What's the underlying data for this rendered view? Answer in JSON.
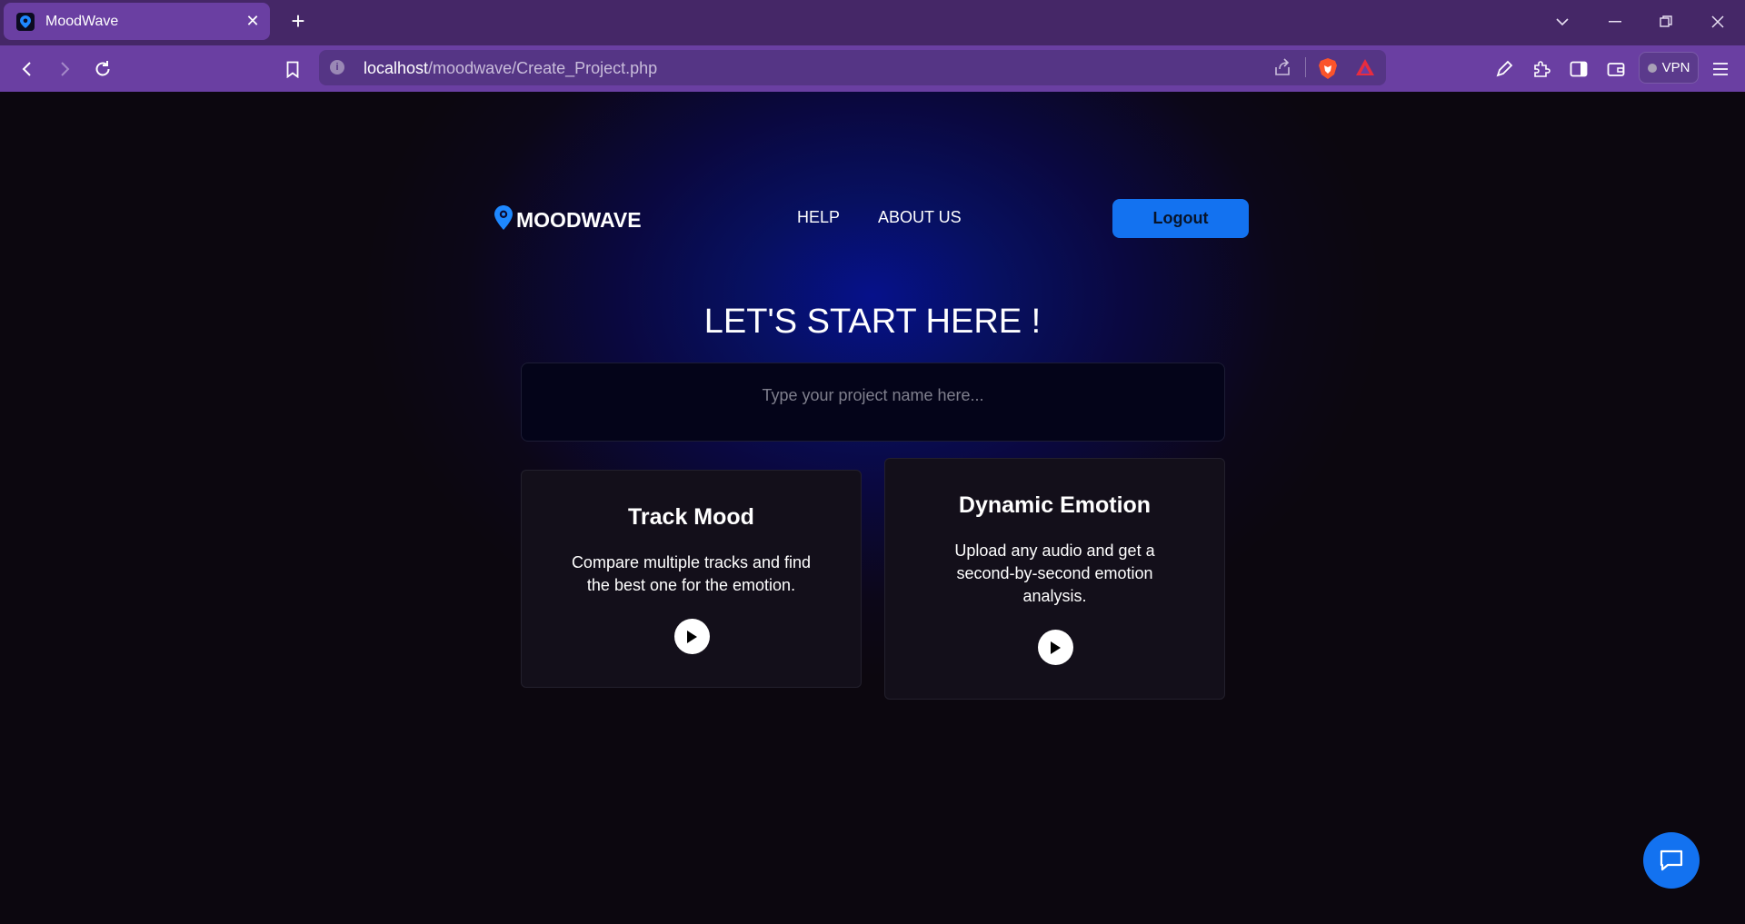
{
  "browser": {
    "tab_title": "MoodWave",
    "url_host": "localhost",
    "url_path": "/moodwave/Create_Project.php",
    "vpn_label": "VPN"
  },
  "header": {
    "logo_text": "MOODWAVE",
    "nav": [
      "HELP",
      "ABOUT US"
    ],
    "logout_label": "Logout"
  },
  "main": {
    "heading": "LET'S START HERE !",
    "project_input": {
      "placeholder": "Type your project name here...",
      "value": ""
    },
    "cards": [
      {
        "title": "Track Mood",
        "description": "Compare multiple tracks and find the best one for the emotion.",
        "icon": "play-icon"
      },
      {
        "title": "Dynamic Emotion",
        "description": "Upload any audio and get a second-by-second emotion analysis.",
        "icon": "play-icon"
      }
    ]
  },
  "colors": {
    "accent": "#1372f0",
    "browser_tab": "#6a3fa2",
    "page_bg": "#0c070f"
  }
}
